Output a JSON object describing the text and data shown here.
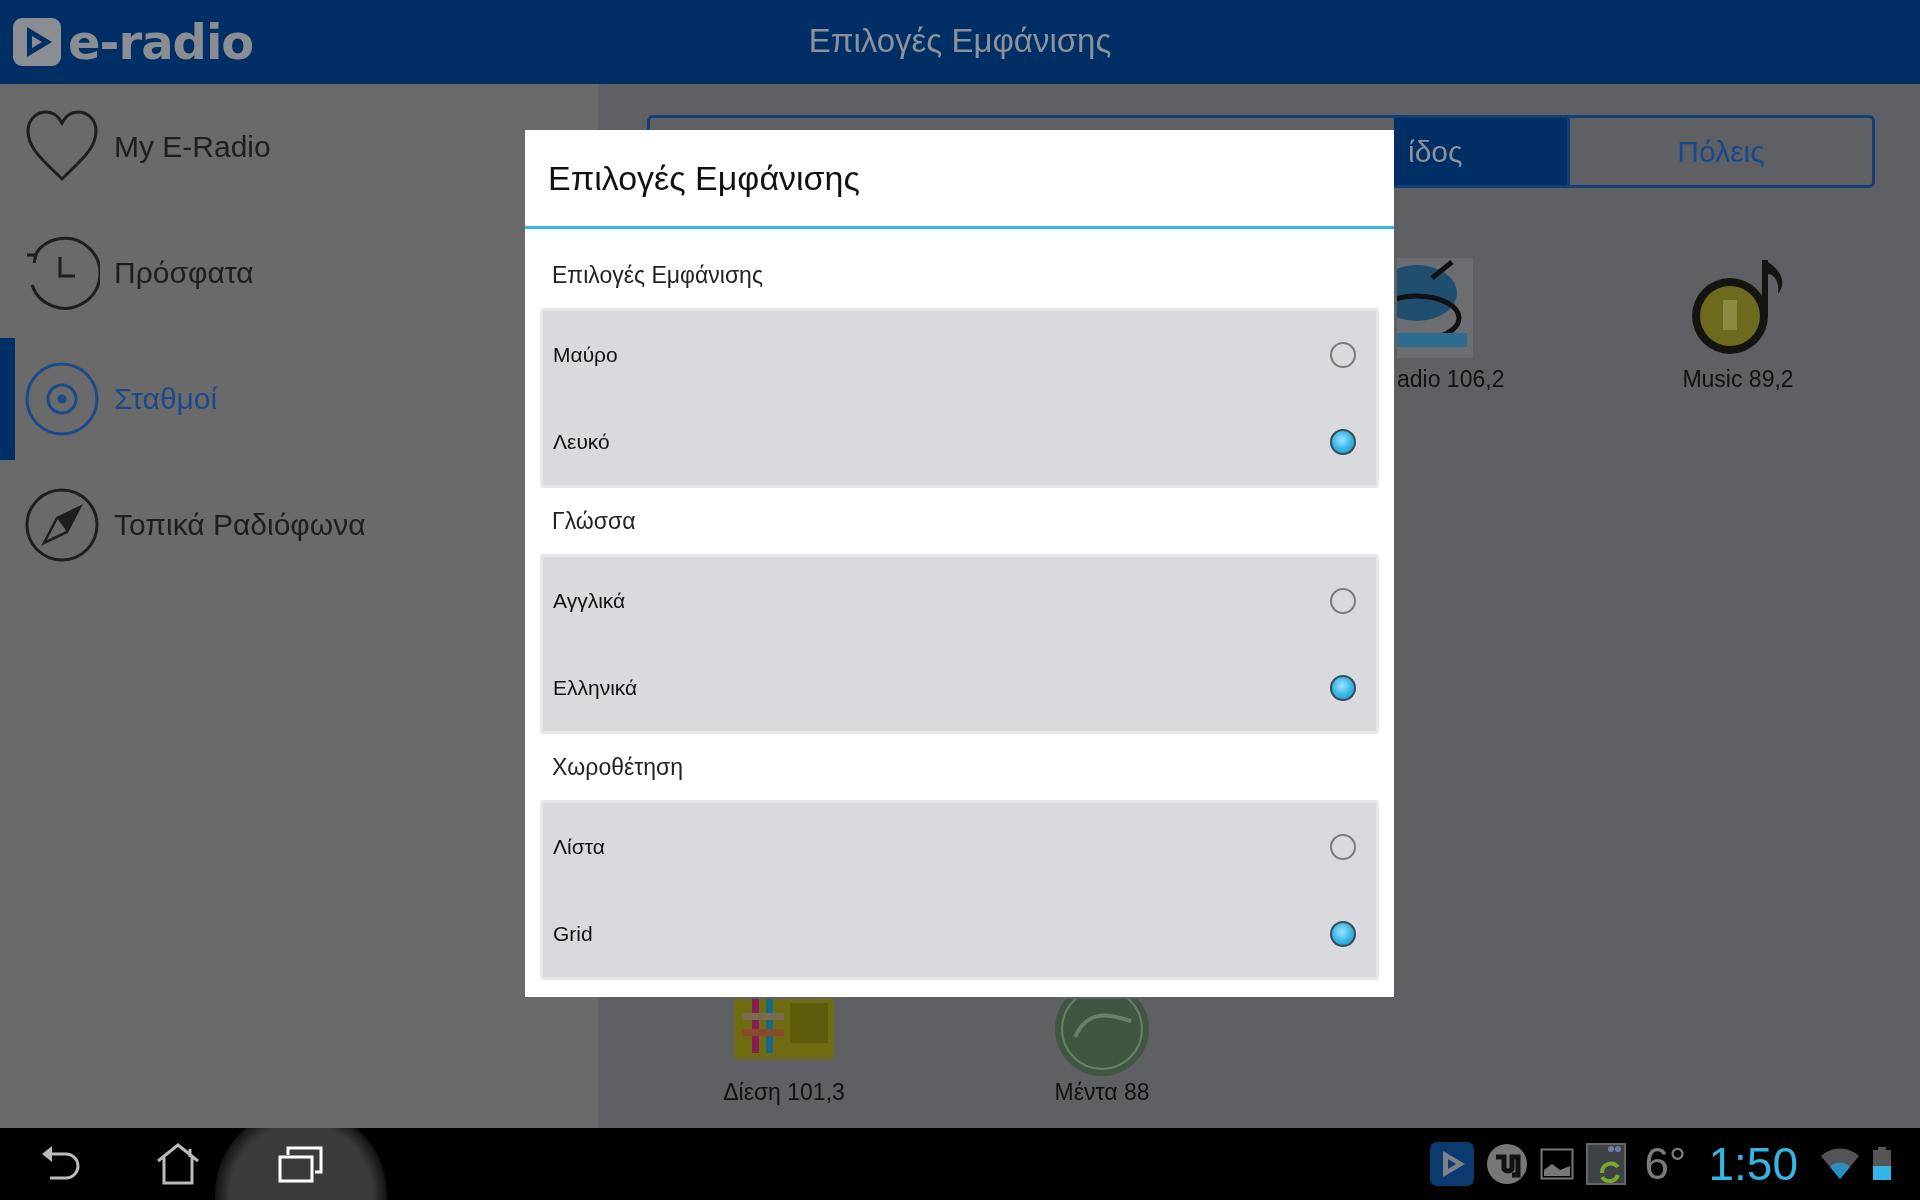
{
  "app_bar": {
    "logo_text": "e-radio",
    "title": "Επιλογές Εμφάνισης"
  },
  "sidebar": {
    "items": [
      {
        "label": "My E-Radio",
        "kind": "heart",
        "selected": false
      },
      {
        "label": "Πρόσφατα",
        "kind": "history",
        "selected": false
      },
      {
        "label": "Σταθμοί",
        "kind": "target",
        "selected": true
      },
      {
        "label": "Τοπικά Ραδιόφωνα",
        "kind": "compass",
        "selected": false
      }
    ]
  },
  "tabs": [
    {
      "label": "ίδος",
      "selected": true
    },
    {
      "label": "Πόλεις",
      "selected": false
    }
  ],
  "station_rows": [
    {
      "stations": [
        {
          "name": "adio 106,2",
          "kind": "round"
        },
        {
          "name": "Music 89,2",
          "kind": "note"
        }
      ]
    },
    {
      "stations": [
        {
          "name": "Δίεση 101,3",
          "kind": "square"
        },
        {
          "name": "Μέντα 88",
          "kind": "badge"
        }
      ]
    }
  ],
  "dialog": {
    "title": "Επιλογές Εμφάνισης",
    "groups": [
      {
        "heading": "Επιλογές Εμφάνισης",
        "options": [
          {
            "label": "Μαύρο",
            "selected": false
          },
          {
            "label": "Λευκό",
            "selected": true
          }
        ]
      },
      {
        "heading": "Γλώσσα",
        "options": [
          {
            "label": "Αγγλικά",
            "selected": false
          },
          {
            "label": "Ελληνικά",
            "selected": true
          }
        ]
      },
      {
        "heading": "Χωροθέτηση",
        "options": [
          {
            "label": "Λίστα",
            "selected": false
          },
          {
            "label": "Grid",
            "selected": true
          }
        ]
      }
    ]
  },
  "system_bar": {
    "weather": "6°",
    "time": "1:50"
  }
}
